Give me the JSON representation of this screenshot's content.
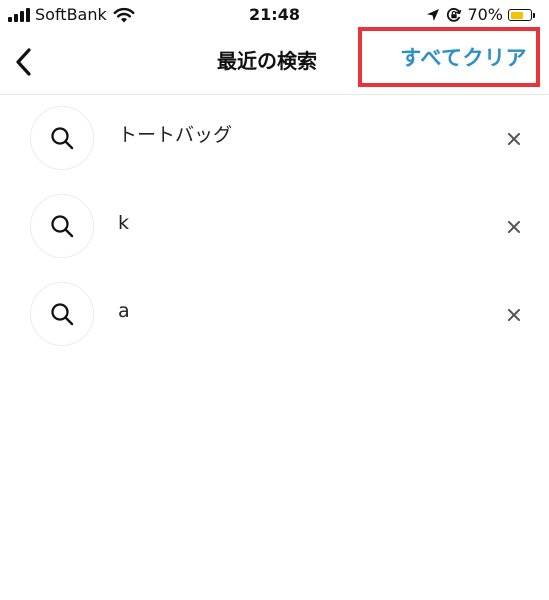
{
  "status_bar": {
    "carrier": "SoftBank",
    "time": "21:48",
    "battery_percent": "70%",
    "battery_level": 0.7,
    "battery_color": "#f2c400",
    "icons": [
      "signal-icon",
      "wifi-icon",
      "location-arrow-icon",
      "orientation-lock-icon",
      "battery-icon"
    ]
  },
  "nav": {
    "back_icon": "chevron-left-icon",
    "title": "最近の検索",
    "clear_all_label": "すべてクリア",
    "highlight_color": "#e8333a",
    "accent_color": "#2d8fc9"
  },
  "recent_searches": [
    {
      "term": "トートバッグ",
      "icon": "search-icon",
      "remove_icon": "close-icon"
    },
    {
      "term": "k",
      "icon": "search-icon",
      "remove_icon": "close-icon"
    },
    {
      "term": "a",
      "icon": "search-icon",
      "remove_icon": "close-icon"
    }
  ]
}
